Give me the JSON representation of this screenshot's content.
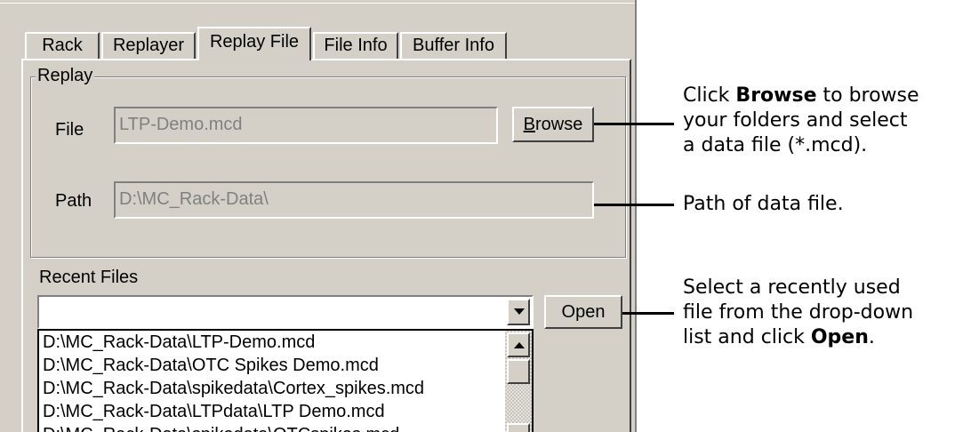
{
  "tabs": [
    {
      "label": "Rack"
    },
    {
      "label": "Replayer"
    },
    {
      "label": "Replay File",
      "active": true
    },
    {
      "label": "File Info"
    },
    {
      "label": "Buffer Info"
    }
  ],
  "replay": {
    "group_label": "Replay",
    "file_label": "File",
    "file_value": "LTP-Demo.mcd",
    "browse_button_rest": "rowse",
    "browse_button_mnemonic": "B",
    "path_label": "Path",
    "path_value": "D:\\MC_Rack-Data\\"
  },
  "recent": {
    "label": "Recent Files",
    "combo_value": "",
    "open_button": "Open",
    "items": [
      "D:\\MC_Rack-Data\\LTP-Demo.mcd",
      "D:\\MC_Rack-Data\\OTC Spikes Demo.mcd",
      "D:\\MC_Rack-Data\\spikedata\\Cortex_spikes.mcd",
      "D:\\MC_Rack-Data\\LTPdata\\LTP Demo.mcd",
      "D:\\MC_Rack-Data\\spikedata\\OTCspikes.mcd"
    ]
  },
  "callouts": {
    "browse": {
      "pre": "Click ",
      "bold": "Browse",
      "post1": " to browse",
      "line2": "your folders and select",
      "line3": "a data file (*.mcd)."
    },
    "path": {
      "text": "Path of data file."
    },
    "open": {
      "line1": "Select a recently used",
      "line2": "file from the drop-down",
      "pre3": "list and click ",
      "bold": "Open",
      "post3": "."
    }
  },
  "icons": {
    "dropdown": "chevron-down-icon",
    "scroll_up": "arrow-up-icon",
    "scroll_down": "arrow-down-icon"
  }
}
